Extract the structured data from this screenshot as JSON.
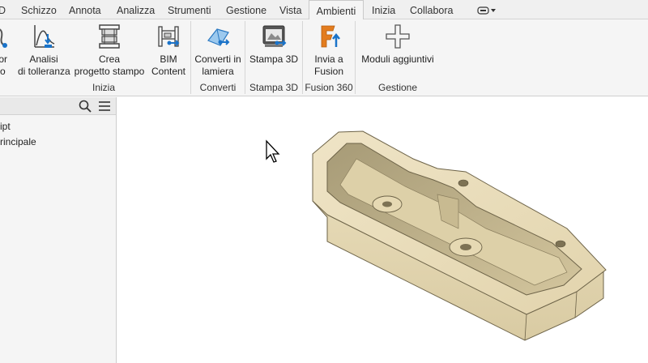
{
  "tabs": [
    {
      "label": "D"
    },
    {
      "label": "Schizzo"
    },
    {
      "label": "Annota"
    },
    {
      "label": "Analizza"
    },
    {
      "label": "Strumenti"
    },
    {
      "label": "Gestione"
    },
    {
      "label": "Vista"
    },
    {
      "label": "Ambienti"
    },
    {
      "label": "Inizia"
    },
    {
      "label": "Collabora"
    }
  ],
  "ribbon": {
    "buttons": [
      {
        "line1": "tor",
        "line2": "io",
        "icon": "partial-tool-icon"
      },
      {
        "line1": "Analisi",
        "line2": "di tolleranza",
        "icon": "tolerance-analysis-icon"
      },
      {
        "line1": "Crea",
        "line2": "progetto stampo",
        "icon": "mold-design-icon"
      },
      {
        "line1": "BIM",
        "line2": "Content",
        "icon": "bim-content-icon"
      },
      {
        "line1": "Converti in",
        "line2": "lamiera",
        "icon": "sheet-metal-icon"
      },
      {
        "line1": "Stampa 3D",
        "line2": "",
        "icon": "print-3d-icon"
      },
      {
        "line1": "Invia a",
        "line2": "Fusion",
        "icon": "fusion-send-icon"
      },
      {
        "line1": "Moduli aggiuntivi",
        "line2": "",
        "icon": "add-ins-plus-icon"
      }
    ],
    "panels": [
      "Inizia",
      "Converti",
      "Stampa 3D",
      "Fusion 360",
      "Gestione"
    ]
  },
  "browser": {
    "items": [
      "ipt",
      "rincipale"
    ],
    "icons": [
      "search-icon",
      "menu-icon"
    ]
  },
  "colors": {
    "ribbon_bg": "#f5f5f5",
    "accent_blue": "#1a73c9",
    "part_body": "#e9dcb8",
    "part_shadow": "#b9ac86",
    "fusion_orange": "#e37c1e"
  }
}
